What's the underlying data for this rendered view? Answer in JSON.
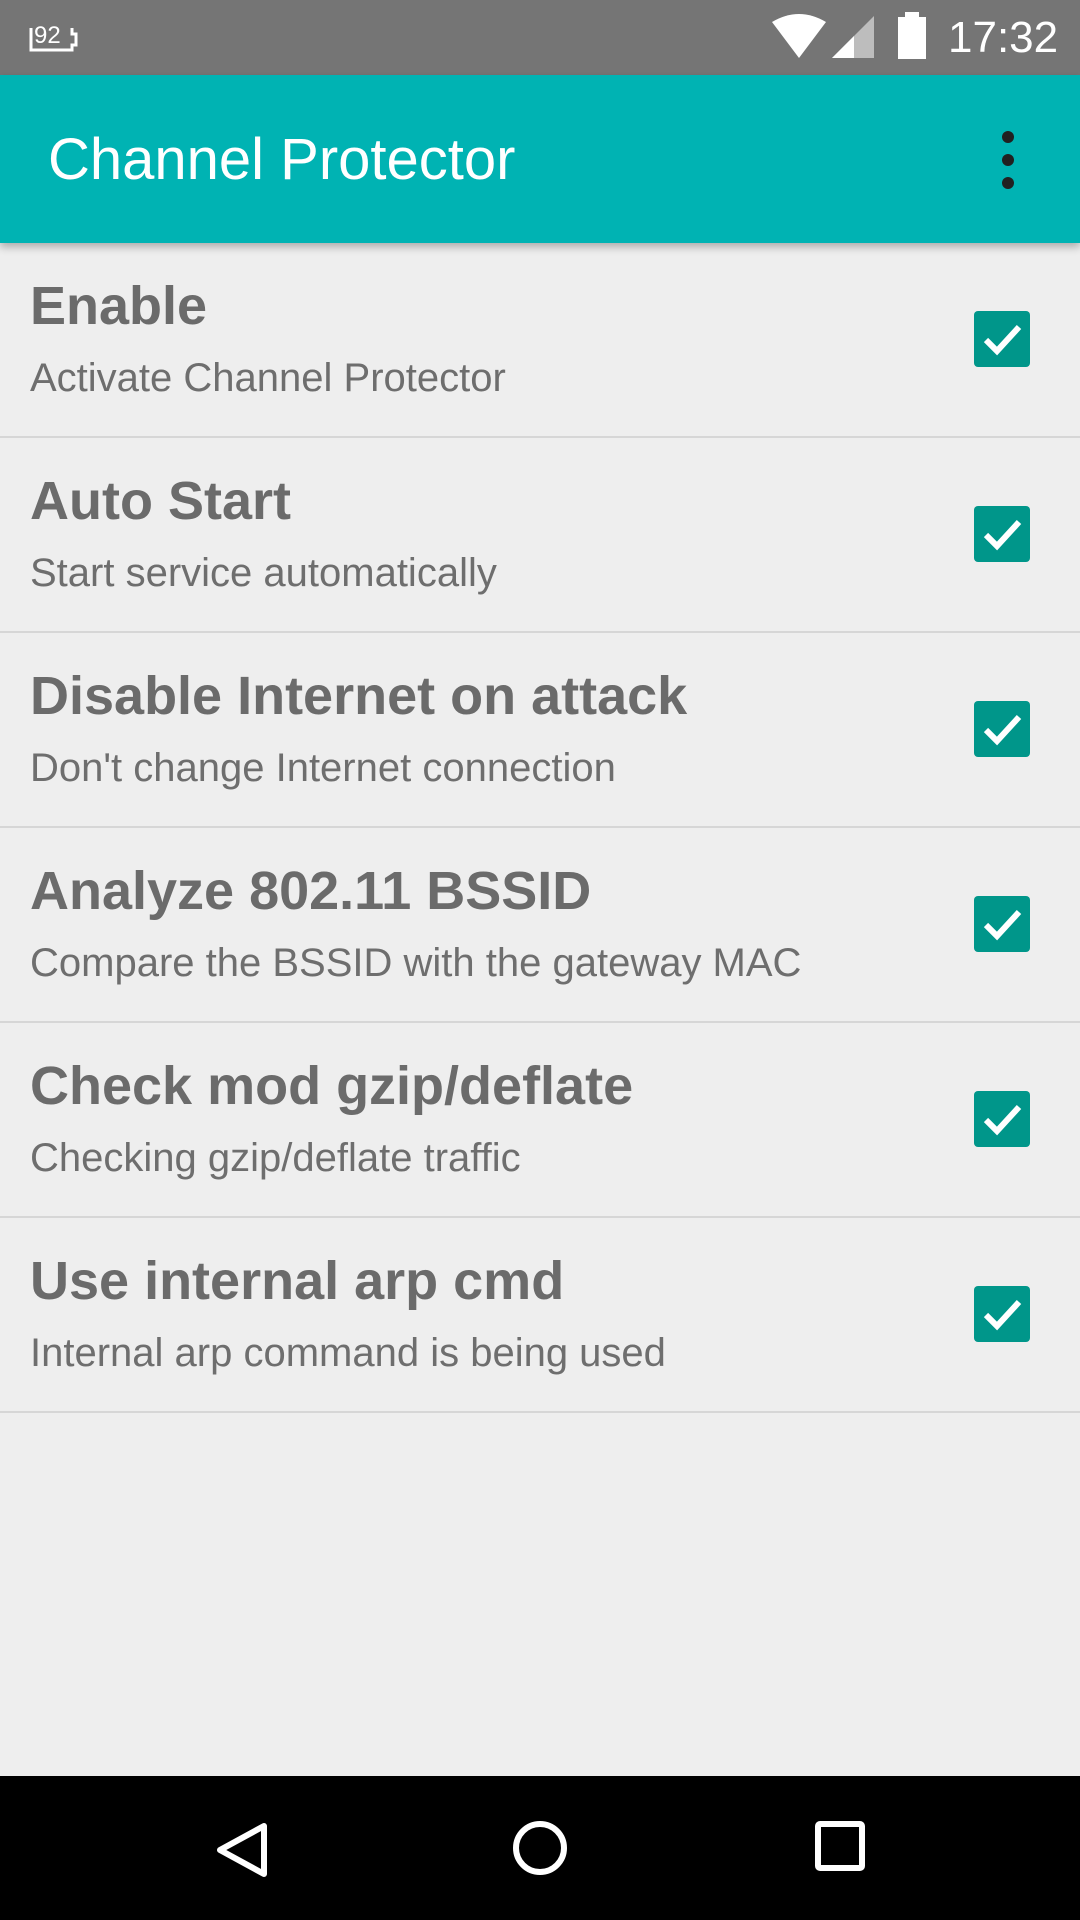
{
  "status_bar": {
    "notification_icon": "notification-92-icon",
    "notification_text": "92",
    "wifi_icon": "wifi-icon",
    "signal_icon": "cell-signal-icon",
    "battery_icon": "battery-icon",
    "time": "17:32"
  },
  "app_bar": {
    "title": "Channel Protector",
    "overflow_icon": "more-vert-icon",
    "color": "#00b3b3"
  },
  "preferences": [
    {
      "title": "Enable",
      "summary": "Activate Channel Protector",
      "checked": true
    },
    {
      "title": "Auto Start",
      "summary": "Start service automatically",
      "checked": true
    },
    {
      "title": "Disable Internet on attack",
      "summary": "Don't change Internet connection",
      "checked": true
    },
    {
      "title": "Analyze 802.11 BSSID",
      "summary": "Compare the BSSID with the gateway MAC",
      "checked": true
    },
    {
      "title": "Check mod gzip/deflate",
      "summary": "Checking gzip/deflate traffic",
      "checked": true
    },
    {
      "title": "Use internal arp cmd",
      "summary": "Internal arp command is being used",
      "checked": true
    }
  ],
  "nav_bar": {
    "back_icon": "back-icon",
    "home_icon": "home-icon",
    "recents_icon": "recents-icon"
  },
  "colors": {
    "checkbox": "#00968a",
    "status_bar": "#757575",
    "background": "#eeeeee"
  }
}
